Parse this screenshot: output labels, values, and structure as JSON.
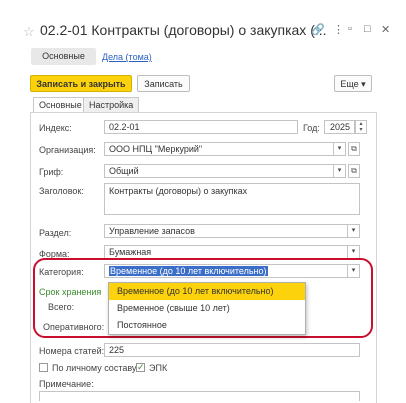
{
  "window": {
    "title": "02.2-01 Контракты (договоры) о закупках (...",
    "link_icon": "link-icon",
    "menu_icon": "more-icon",
    "minimize_icon": "minimize-icon",
    "maximize_icon": "maximize-icon",
    "close_icon": "close-icon"
  },
  "nav": {
    "main": "Основные",
    "link": "Дела (тома)"
  },
  "toolbar": {
    "save_close": "Записать и закрыть",
    "save": "Записать",
    "more": "Еще"
  },
  "tabs": {
    "main": "Основные",
    "settings": "Настройка"
  },
  "form": {
    "index_label": "Индекс:",
    "index_value": "02.2-01",
    "year_label": "Год:",
    "year_value": "2025",
    "org_label": "Организация:",
    "org_value": "ООО НПЦ \"Меркурий\"",
    "grif_label": "Гриф:",
    "grif_value": "Общий",
    "title_label": "Заголовок:",
    "title_value": "Контракты (договоры) о закупках",
    "section_label": "Раздел:",
    "section_value": "Управление запасов",
    "form_label": "Форма:",
    "form_value": "Бумажная",
    "category_label": "Категория:",
    "category_value": "Временное (до 10 лет включительно)",
    "storage_label": "Срок хранения",
    "total_label": "Всего:",
    "oper_label": "Оперативного:",
    "articles_label": "Номера статей:",
    "articles_value": "225",
    "personal_label": "По личному составу",
    "epk_label": "ЭПК",
    "note_label": "Примечание:"
  },
  "dropdown": {
    "options": [
      "Временное (до 10 лет включительно)",
      "Временное (свыше 10 лет)",
      "Постоянное"
    ],
    "selected_index": 0
  },
  "colors": {
    "accent": "#fbd20c",
    "highlight_ring": "#c8102e",
    "group_title": "#3a8b2c"
  }
}
